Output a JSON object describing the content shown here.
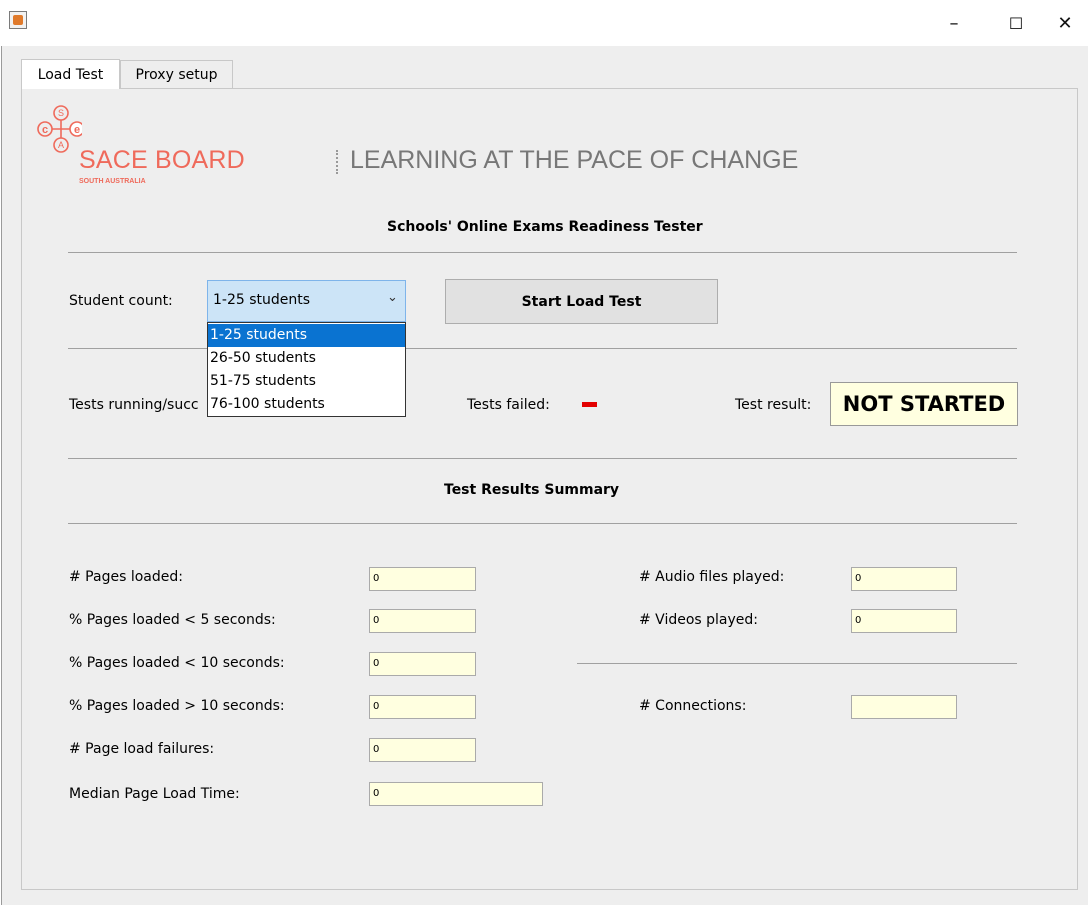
{
  "window": {
    "title": "",
    "minimize": "–",
    "maximize": "☐",
    "close": "✕"
  },
  "tabs": [
    {
      "label": "Load Test",
      "active": true
    },
    {
      "label": "Proxy setup",
      "active": false
    }
  ],
  "brand": {
    "logo_letters": [
      "S",
      "c",
      "e",
      "A"
    ],
    "name": "SACE BOARD",
    "sub": "SOUTH AUSTRALIA",
    "tagline": "LEARNING AT THE PACE OF CHANGE",
    "color": "#ef6a5b"
  },
  "main": {
    "heading": "Schools' Online Exams Readiness Tester",
    "student_count_label": "Student count:",
    "student_count_value": "1-25 students",
    "student_count_options": [
      "1-25 students",
      "26-50 students",
      "51-75 students",
      "76-100 students"
    ],
    "start_button": "Start Load Test",
    "tests_running_label": "Tests running/succ",
    "tests_failed_label": "Tests failed:",
    "test_result_label": "Test result:",
    "test_result_value": "NOT STARTED"
  },
  "summary": {
    "heading": "Test Results Summary",
    "left": [
      {
        "label": "# Pages loaded:",
        "value": "0"
      },
      {
        "label": "% Pages loaded < 5 seconds:",
        "value": "0"
      },
      {
        "label": "% Pages loaded < 10 seconds:",
        "value": "0"
      },
      {
        "label": "% Pages loaded > 10 seconds:",
        "value": "0"
      },
      {
        "label": "# Page load failures:",
        "value": "0"
      },
      {
        "label": "Median Page Load Time:",
        "value": "0"
      }
    ],
    "right": [
      {
        "label": "# Audio files played:",
        "value": "0"
      },
      {
        "label": "# Videos played:",
        "value": "0"
      },
      {
        "label": "# Connections:",
        "value": ""
      }
    ]
  },
  "colors": {
    "selection": "#0a73d1",
    "field_bg": "#ffffe0",
    "failed_indicator": "#e30000"
  }
}
